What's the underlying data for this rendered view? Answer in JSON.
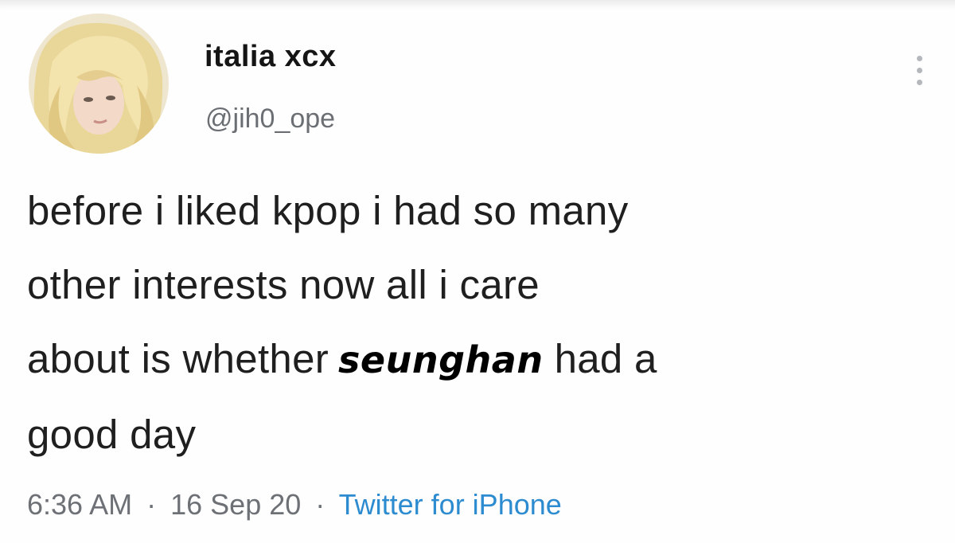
{
  "tweet": {
    "display_name": "italia xcx",
    "handle": "@jih0_ope",
    "text_lines": [
      "before i liked kpop i had so many",
      "other interests now all i care",
      "about is whether",
      "good day"
    ],
    "highlight_name": "seunghan",
    "text_after_highlight": "had a",
    "time": "6:36 AM",
    "separator": "·",
    "date": "16 Sep 20",
    "source": "Twitter for iPhone"
  },
  "icons": {
    "more": "more-options-icon",
    "avatar": "avatar-image"
  },
  "colors": {
    "source_link": "#2d8bd0",
    "meta_text": "#6d7176",
    "handle": "#6b6f73"
  }
}
